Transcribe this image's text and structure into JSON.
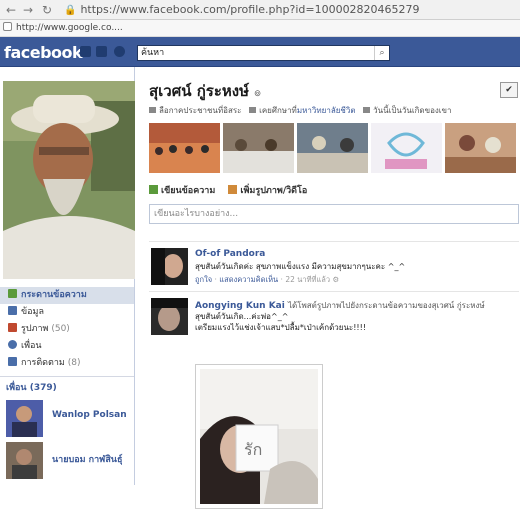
{
  "browser": {
    "url": "https://www.facebook.com/profile.php?id=100002820465279",
    "bookmark": "http://www.google.co...."
  },
  "header": {
    "logo": "facebook",
    "search_value": "ค้นหา"
  },
  "profile": {
    "name": "สุเวศน์ กู่ระหงษ์",
    "name_suffix": "๏",
    "options_glyph": "✔",
    "info": [
      {
        "text": "ลือกาคประชาชนที่อิสระ",
        "link": false
      },
      {
        "text": "เคยศึกษาที่",
        "link": false
      },
      {
        "text": "มหาวิทยาลัยชีวิต",
        "link": true
      },
      {
        "text": "วันนี้เป็นวันเกิดของเขา",
        "link": false
      }
    ]
  },
  "sidebar": {
    "items": [
      {
        "label": "กระดานข้อความ",
        "count": "",
        "active": true,
        "icon_color": "#5b9a3b"
      },
      {
        "label": "ข้อมูล",
        "count": "",
        "active": false,
        "icon_color": "#4a6ea9"
      },
      {
        "label": "รูปภาพ",
        "count": "(50)",
        "active": false,
        "icon_color": "#c0492f"
      },
      {
        "label": "เพื่อน",
        "count": "",
        "active": false,
        "icon_color": "#4a6ea9"
      },
      {
        "label": "การติดตาม",
        "count": "(8)",
        "active": false,
        "icon_color": "#4a6ea9"
      }
    ],
    "friends_heading": "เพื่อน (379)",
    "friends": [
      {
        "name": "Wanlop Polsan"
      },
      {
        "name": "นายบอม กาฬสินธุ์"
      }
    ]
  },
  "composer": {
    "tab_post": "เขียนข้อความ",
    "tab_photo": "เพิ่มรูปภาพ/วิดีโอ",
    "placeholder": "เขียนอะไรบางอย่าง..."
  },
  "stories": [
    {
      "actor": "Of-of Pandora",
      "actor_rest": "",
      "message": "สุขสันต์วันเกิดค่ะ สุขภาพแข็งแรง มีความสุขมากๆนะคะ ^_^",
      "message2": "",
      "meta_like": "ถูกใจ",
      "meta_comment": "แสดงความคิดเห็น",
      "meta_time": "22 นาทีที่แล้ว"
    },
    {
      "actor": "Aongying Kun Kai",
      "actor_rest": "ได้โพสต์รูปภาพไปยังกระดานข้อความของสุเวศน์ กู่ระหงษ์",
      "message": "สุขสันต์วันเกิด...ค่ะพ่อ^_^",
      "message2": "เตรียมแรงไว้แช่งเจ้าแสบ*ปลื้ม*เป่าเค้กด้วยนะ!!!!",
      "photo_card_text": "รัก"
    }
  ],
  "colors": {
    "brand": "#3b5998",
    "link": "#3b5998"
  }
}
